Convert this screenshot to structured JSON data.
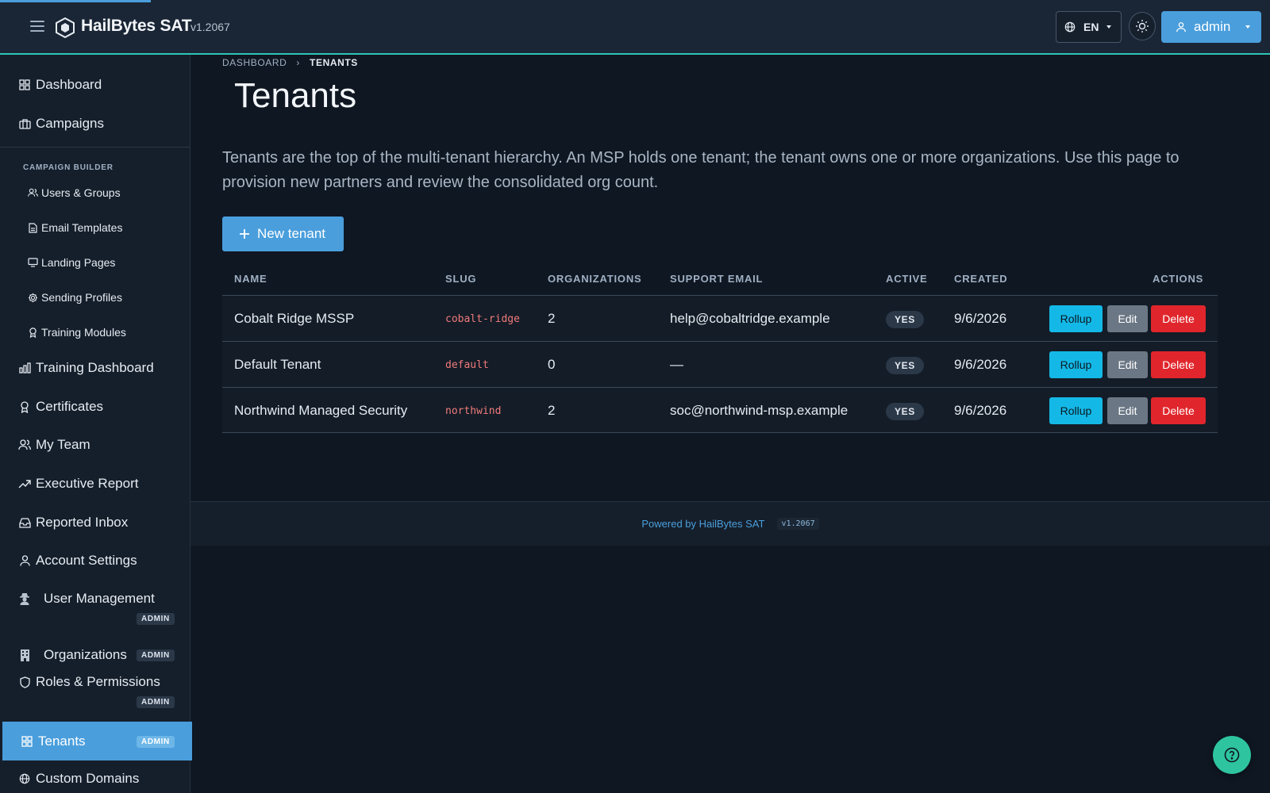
{
  "header": {
    "brand": "HailBytes SAT",
    "version": "v1.2067",
    "language": "EN",
    "user": "admin"
  },
  "sidebar": {
    "items_top": [
      {
        "label": "Dashboard",
        "icon": "grid-icon"
      },
      {
        "label": "Campaigns",
        "icon": "briefcase-icon"
      }
    ],
    "section_label": "CAMPAIGN BUILDER",
    "builder_items": [
      {
        "label": "Users & Groups",
        "icon": "users-icon"
      },
      {
        "label": "Email Templates",
        "icon": "file-icon"
      },
      {
        "label": "Landing Pages",
        "icon": "monitor-icon"
      },
      {
        "label": "Sending Profiles",
        "icon": "gear-icon"
      },
      {
        "label": "Training Modules",
        "icon": "award-icon"
      }
    ],
    "items_main": [
      {
        "label": "Training Dashboard",
        "icon": "bar-chart-icon"
      },
      {
        "label": "Certificates",
        "icon": "award-icon"
      },
      {
        "label": "My Team",
        "icon": "users-icon"
      },
      {
        "label": "Executive Report",
        "icon": "trending-up-icon"
      },
      {
        "label": "Reported Inbox",
        "icon": "inbox-icon"
      },
      {
        "label": "Account Settings",
        "icon": "user-icon"
      },
      {
        "label": "User Management",
        "icon": "detective-icon",
        "badge": "ADMIN"
      },
      {
        "label": "Organizations",
        "icon": "building-icon",
        "badge": "ADMIN"
      },
      {
        "label": "Roles & Permissions",
        "icon": "shield-icon",
        "badge": "ADMIN"
      },
      {
        "label": "Tenants",
        "icon": "grid-icon",
        "badge": "ADMIN"
      },
      {
        "label": "Custom Domains",
        "icon": "globe-icon"
      }
    ]
  },
  "breadcrumb": {
    "parent": "DASHBOARD",
    "current": "TENANTS"
  },
  "page": {
    "title": "Tenants",
    "description": "Tenants are the top of the multi-tenant hierarchy. An MSP holds one tenant; the tenant owns one or more organizations. Use this page to provision new partners and review the consolidated org count.",
    "new_button": "New tenant"
  },
  "table": {
    "columns": [
      "NAME",
      "SLUG",
      "ORGANIZATIONS",
      "SUPPORT EMAIL",
      "ACTIVE",
      "CREATED",
      "ACTIONS"
    ],
    "rows": [
      {
        "name": "Cobalt Ridge MSSP",
        "slug": "cobalt-ridge",
        "orgs": "2",
        "email": "help@cobaltridge.example",
        "active": "YES",
        "created": "9/6/2026"
      },
      {
        "name": "Default Tenant",
        "slug": "default",
        "orgs": "0",
        "email": "—",
        "active": "YES",
        "created": "9/6/2026"
      },
      {
        "name": "Northwind Managed Security",
        "slug": "northwind",
        "orgs": "2",
        "email": "soc@northwind-msp.example",
        "active": "YES",
        "created": "9/6/2026"
      }
    ],
    "actions": {
      "rollup": "Rollup",
      "edit": "Edit",
      "delete": "Delete"
    }
  },
  "footer": {
    "powered": "Powered by HailBytes SAT",
    "version": "v1.2067"
  },
  "colors": {
    "accent": "#4a9edc",
    "teal": "#2ec4b6",
    "danger": "#e0262c",
    "info": "#14b8e6"
  }
}
